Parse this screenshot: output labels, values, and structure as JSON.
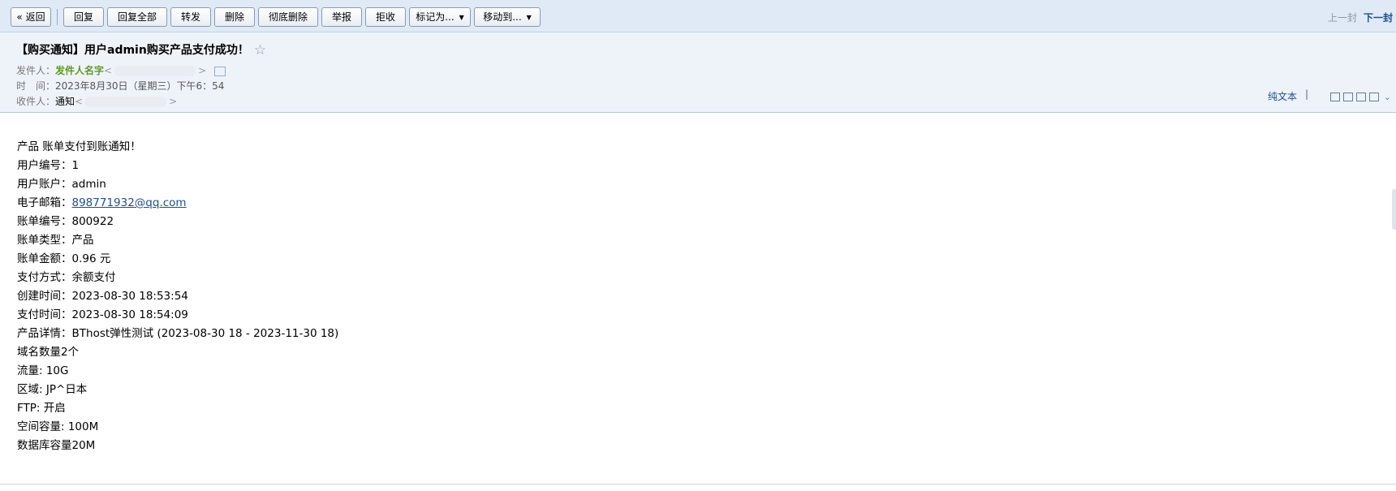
{
  "toolbar": {
    "back": "« 返回",
    "reply": "回复",
    "reply_all": "回复全部",
    "forward": "转发",
    "delete": "删除",
    "delete_permanently": "彻底删除",
    "report": "举报",
    "reject": "拒收",
    "mark_as": "标记为...",
    "move_to": "移动到...",
    "prev": "上一封",
    "next": "下一封"
  },
  "email": {
    "subject": "【购买通知】用户admin购买产品支付成功！",
    "sender_label": "发件人：",
    "sender_name": "发件人名字",
    "time_label": "时　间：",
    "time_value": "2023年8月30日（星期三）下午6：54",
    "recipient_label": "收件人：",
    "recipient_name": "通知",
    "plain_text": "纯文本"
  },
  "body": {
    "intro": "产品 账单支付到账通知！",
    "user_id": "用户编号：1",
    "user_account": "用户账户：admin",
    "email_label": "电子邮箱：",
    "email_value": "898771932@qq.com",
    "bill_no": "账单编号：800922",
    "bill_type": "账单类型：产品",
    "bill_amount": "账单金额：0.96 元",
    "payment_method": "支付方式：余额支付",
    "created_time": "创建时间：2023-08-30 18:53:54",
    "paid_time": "支付时间：2023-08-30 18:54:09",
    "product_detail": "产品详情：BThost弹性测试 (2023-08-30 18 - 2023-11-30 18)",
    "domain_count": "域名数量2个",
    "traffic": "流量: 10G",
    "region": "区域: JP^日本",
    "ftp": "FTP: 开启",
    "space": "空间容量: 100M",
    "db_capacity": "数据库容量20M"
  }
}
